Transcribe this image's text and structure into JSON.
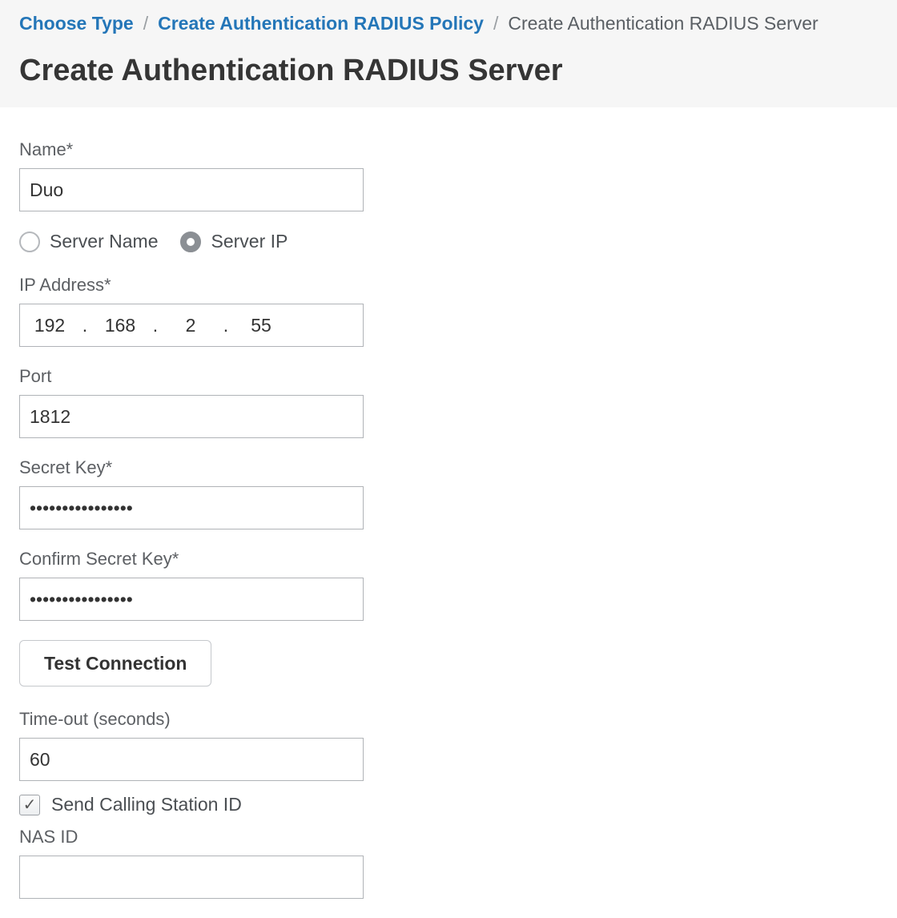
{
  "breadcrumb": {
    "items": [
      {
        "label": "Choose Type",
        "link": true
      },
      {
        "label": "Create Authentication RADIUS Policy",
        "link": true
      },
      {
        "label": "Create Authentication RADIUS Server",
        "link": false
      }
    ],
    "separator": "/"
  },
  "page_title": "Create Authentication RADIUS Server",
  "form": {
    "name": {
      "label": "Name*",
      "value": "Duo"
    },
    "server_mode": {
      "options": [
        {
          "label": "Server Name",
          "selected": false
        },
        {
          "label": "Server IP",
          "selected": true
        }
      ]
    },
    "ip": {
      "label": "IP Address*",
      "octets": [
        "192",
        "168",
        "2",
        "55"
      ]
    },
    "port": {
      "label": "Port",
      "value": "1812"
    },
    "secret": {
      "label": "Secret Key*",
      "value": "••••••••••••••••"
    },
    "confirm_secret": {
      "label": "Confirm Secret Key*",
      "value": "••••••••••••••••"
    },
    "test_button": "Test Connection",
    "timeout": {
      "label": "Time-out (seconds)",
      "value": "60"
    },
    "calling_station": {
      "label": "Send Calling Station ID",
      "checked": true
    },
    "nas_id": {
      "label": "NAS ID",
      "value": ""
    }
  }
}
